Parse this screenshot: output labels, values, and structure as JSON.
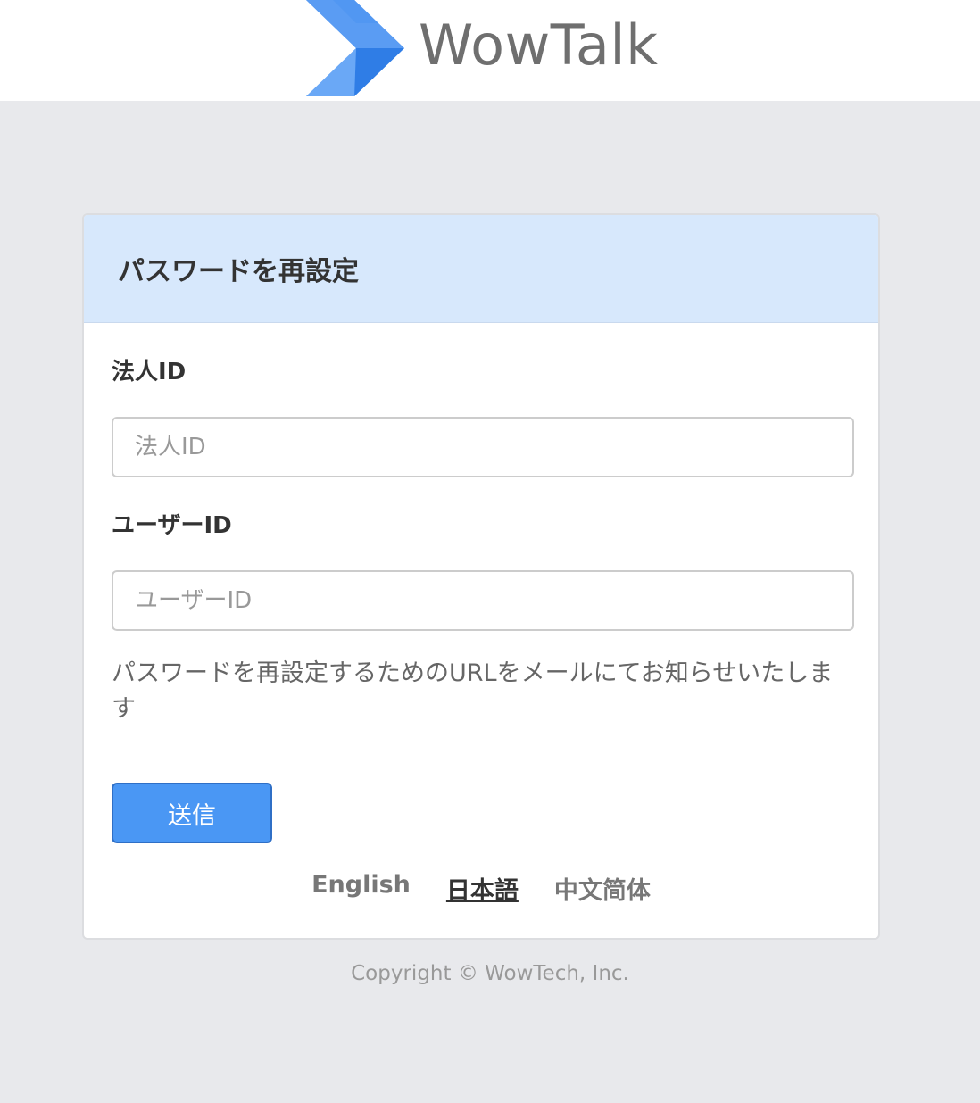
{
  "header": {
    "logo_text": "WowTalk",
    "logo_icon": "chevron-logo-icon",
    "logo_color": "#3d8af0"
  },
  "card": {
    "title": "パスワードを再設定",
    "header_color": "#d7e8fc"
  },
  "form": {
    "company_id_label": "法人ID",
    "company_id_placeholder": "法人ID",
    "company_id_value": "",
    "user_id_label": "ユーザーID",
    "user_id_placeholder": "ユーザーID",
    "user_id_value": "",
    "info_text": "パスワードを再設定するためのURLをメールにてお知らせいたします",
    "submit_label": "送信",
    "submit_color": "#4a97f4"
  },
  "languages": [
    {
      "label": "English",
      "active": false
    },
    {
      "label": "日本語",
      "active": true
    },
    {
      "label": "中文简体",
      "active": false
    }
  ],
  "footer": {
    "copyright": "Copyright © WowTech, Inc."
  }
}
